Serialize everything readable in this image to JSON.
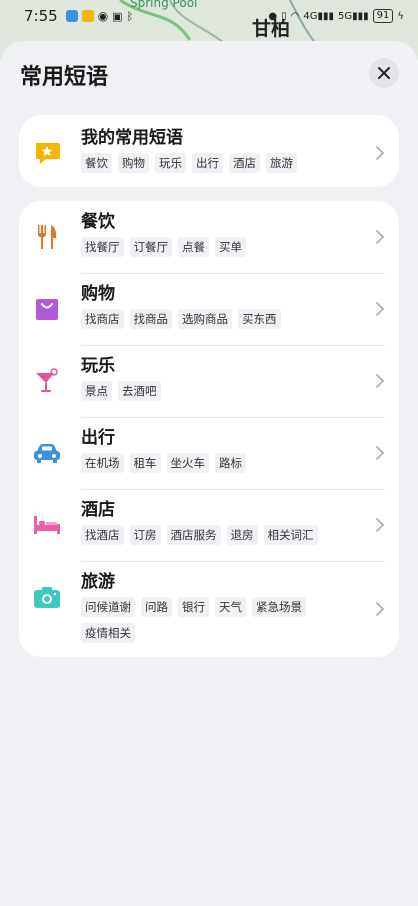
{
  "status_bar": {
    "time": "7:55",
    "battery": "91"
  },
  "map": {
    "label_1": "Spring Pool",
    "label_2": "甘柏"
  },
  "sheet": {
    "title": "常用短语"
  },
  "favorites": {
    "title": "我的常用短语",
    "icon": "star-bubble-icon",
    "tags": [
      "餐饮",
      "购物",
      "玩乐",
      "出行",
      "酒店",
      "旅游"
    ]
  },
  "categories": [
    {
      "title": "餐饮",
      "icon": "fork-knife-icon",
      "color": "#e0782a",
      "tags": [
        "找餐厅",
        "订餐厅",
        "点餐",
        "买单"
      ]
    },
    {
      "title": "购物",
      "icon": "shopping-bag-icon",
      "color": "#b05ad6",
      "tags": [
        "找商店",
        "找商品",
        "选购商品",
        "买东西"
      ]
    },
    {
      "title": "玩乐",
      "icon": "cocktail-icon",
      "color": "#e2559a",
      "tags": [
        "景点",
        "去酒吧"
      ]
    },
    {
      "title": "出行",
      "icon": "car-icon",
      "color": "#3d8fe0",
      "tags": [
        "在机场",
        "租车",
        "坐火车",
        "路标"
      ]
    },
    {
      "title": "酒店",
      "icon": "bed-icon",
      "color": "#ea5fa8",
      "tags": [
        "找酒店",
        "订房",
        "酒店服务",
        "退房",
        "相关词汇"
      ]
    },
    {
      "title": "旅游",
      "icon": "camera-icon",
      "color": "#3ec9c0",
      "tags": [
        "问候道谢",
        "问路",
        "银行",
        "天气",
        "紧急场景",
        "疫情相关"
      ]
    }
  ]
}
